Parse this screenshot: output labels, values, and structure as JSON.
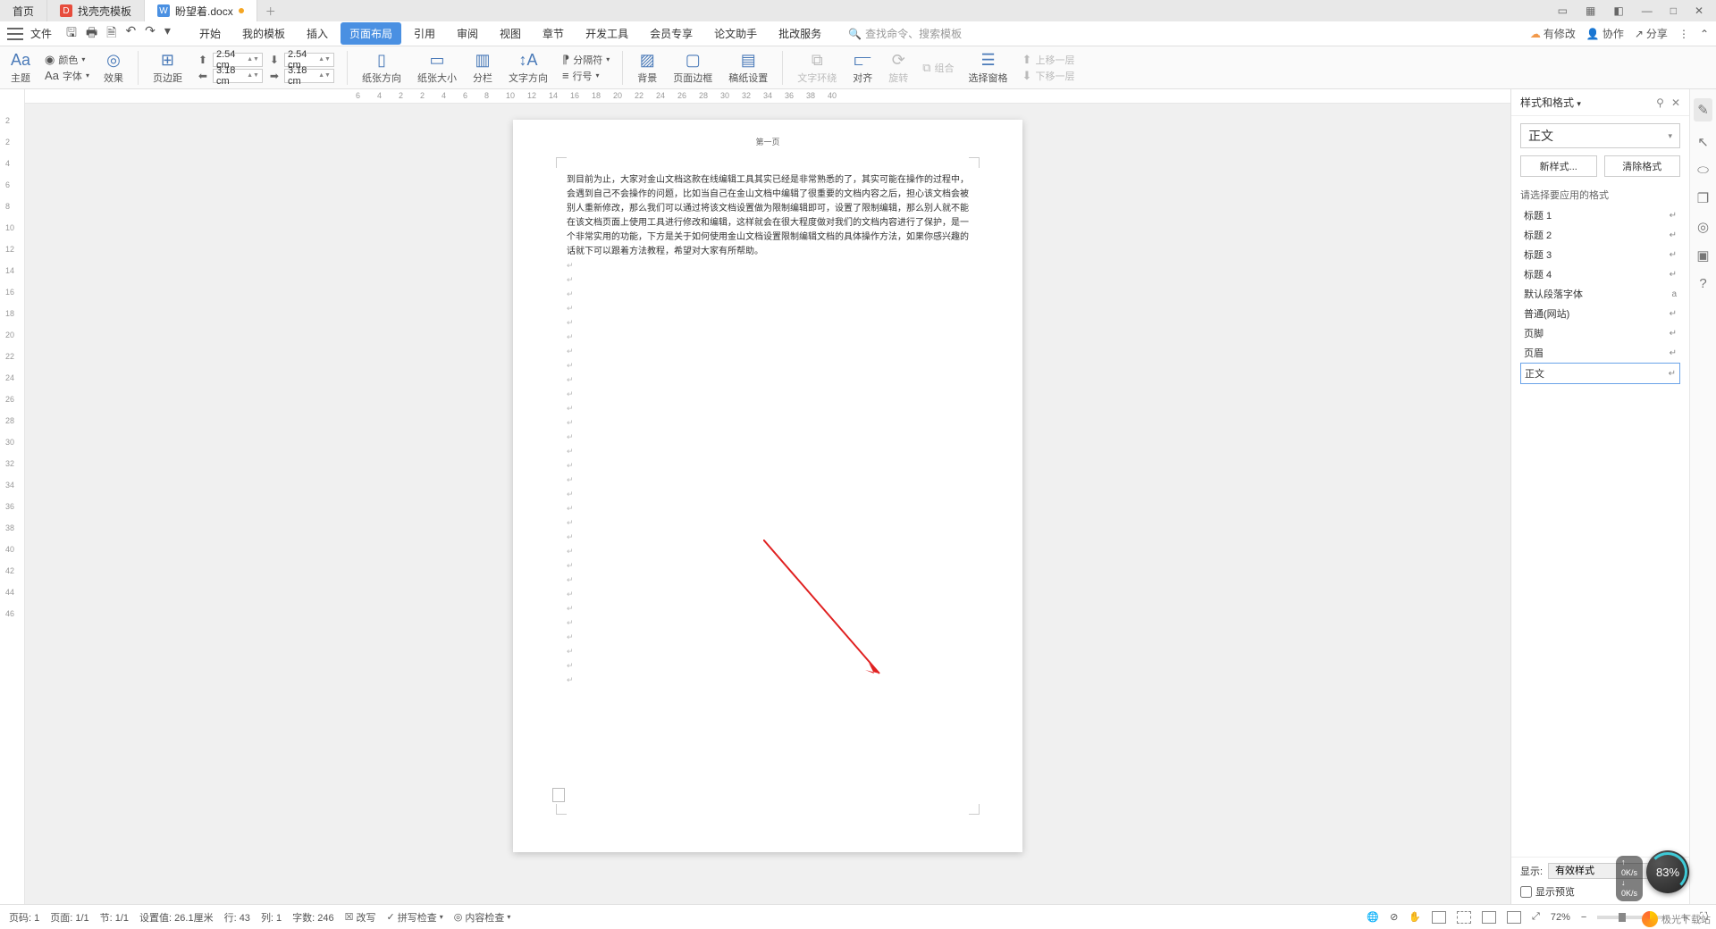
{
  "tabs": {
    "home": "首页",
    "t1": "找壳壳模板",
    "t2": "盼望着.docx"
  },
  "window_icons": [
    "▭",
    "▦",
    "◧",
    "—",
    "□",
    "✕"
  ],
  "menubar": {
    "file": "文件",
    "ribbon_tabs": [
      "开始",
      "我的模板",
      "插入",
      "页面布局",
      "引用",
      "审阅",
      "视图",
      "章节",
      "开发工具",
      "会员专享",
      "论文助手",
      "批改服务"
    ],
    "active_tab_index": 3,
    "search_placeholder": "查找命令、搜索模板",
    "right": {
      "pending": "有修改",
      "collab": "协作",
      "share": "分享"
    }
  },
  "ribbon": {
    "theme": "主题",
    "color": "颜色",
    "font": "字体",
    "effect": "效果",
    "pgmargin": "页边距",
    "margins": {
      "top": "2.54 cm",
      "bottom": "2.54 cm",
      "left": "3.18 cm",
      "right": "3.18 cm"
    },
    "orientation": "纸张方向",
    "size": "纸张大小",
    "columns": "分栏",
    "textdir": "文字方向",
    "breaks": "分隔符",
    "lineno": "行号",
    "bg": "背景",
    "border": "页面边框",
    "paper": "稿纸设置",
    "wrap": "文字环绕",
    "align": "对齐",
    "rotate": "旋转",
    "combine": "组合",
    "selpane": "选择窗格",
    "forward": "上移一层",
    "backward": "下移一层"
  },
  "hruler_ticks": [
    "6",
    "4",
    "2",
    "2",
    "4",
    "6",
    "8",
    "10",
    "12",
    "14",
    "16",
    "18",
    "20",
    "22",
    "24",
    "26",
    "28",
    "30",
    "32",
    "34",
    "36",
    "38",
    "40"
  ],
  "vruler_ticks": [
    "2",
    "2",
    "4",
    "6",
    "8",
    "10",
    "12",
    "14",
    "16",
    "18",
    "20",
    "22",
    "24",
    "26",
    "28",
    "30",
    "32",
    "34",
    "36",
    "38",
    "40",
    "42",
    "44",
    "46"
  ],
  "doc": {
    "header": "第一页",
    "body": "到目前为止，大家对金山文档这款在线编辑工具其实已经是非常熟悉的了，其实可能在操作的过程中，会遇到自己不会操作的问题，比如当自己在金山文档中编辑了很重要的文档内容之后，担心该文档会被别人重新修改，那么我们可以通过将该文档设置做为限制编辑即可，设置了限制编辑，那么别人就不能在该文档页面上使用工具进行修改和编辑，这样就会在很大程度做对我们的文档内容进行了保护，是一个非常实用的功能，下方是关于如何使用金山文档设置限制编辑文档的具体操作方法，如果你感兴趣的话就下可以跟着方法教程，希望对大家有所帮助。"
  },
  "panel": {
    "title": "样式和格式",
    "current": "正文",
    "new_btn": "新样式...",
    "clear_btn": "清除格式",
    "prompt": "请选择要应用的格式",
    "styles": [
      "标题 1",
      "标题 2",
      "标题 3",
      "标题 4",
      "默认段落字体",
      "普通(网站)",
      "页脚",
      "页眉",
      "正文"
    ],
    "selected_index": 8,
    "show_label": "显示:",
    "show_value": "有效样式",
    "preview": "显示预览"
  },
  "status": {
    "page_label": "页码: 1",
    "pages": "页面: 1/1",
    "section": "节: 1/1",
    "setval": "设置值: 26.1厘米",
    "row": "行: 43",
    "col": "列: 1",
    "words": "字数: 246",
    "track": "改写",
    "spell": "拼写检查",
    "content": "内容检查",
    "zoom": "72%"
  },
  "gauge": {
    "pct": "83%",
    "up": "0K/s",
    "down": "0K/s"
  },
  "watermark": "极光下载站"
}
